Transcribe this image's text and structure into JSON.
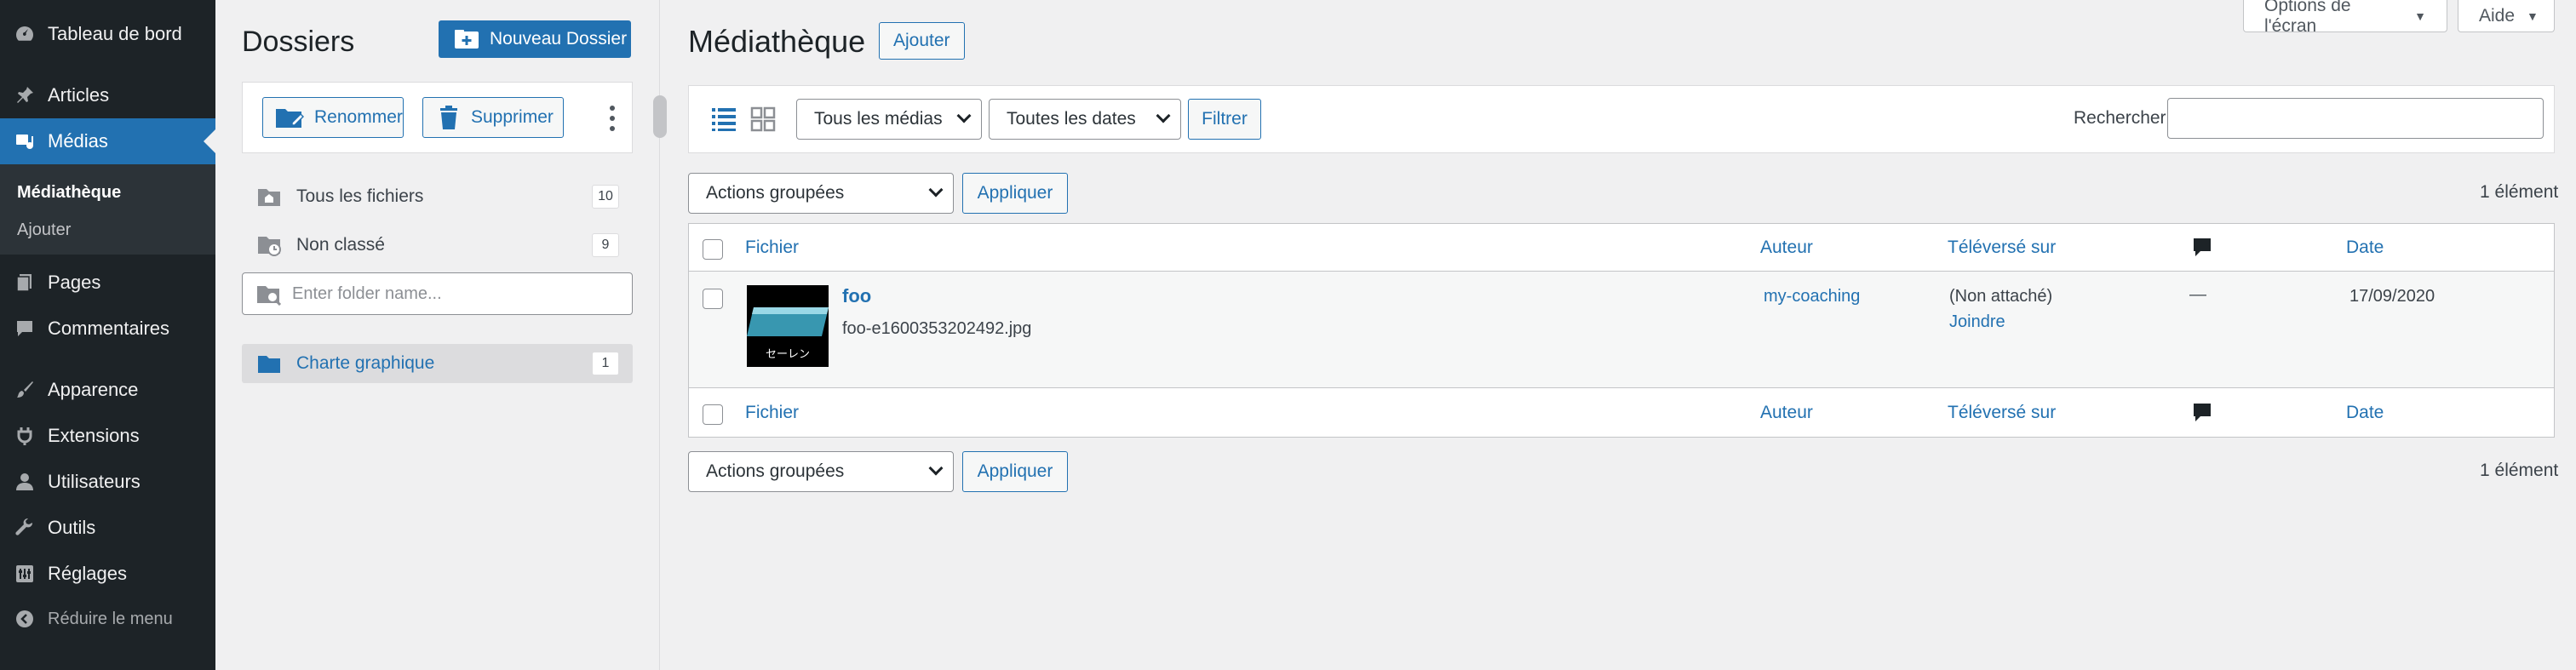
{
  "sidebar": {
    "items": [
      {
        "label": "Tableau de bord",
        "icon": "dashboard-icon"
      },
      {
        "label": "Articles",
        "icon": "pin-icon"
      },
      {
        "label": "Médias",
        "icon": "media-icon"
      },
      {
        "label": "Pages",
        "icon": "pages-icon"
      },
      {
        "label": "Commentaires",
        "icon": "comments-icon"
      },
      {
        "label": "Apparence",
        "icon": "brush-icon"
      },
      {
        "label": "Extensions",
        "icon": "plugin-icon"
      },
      {
        "label": "Utilisateurs",
        "icon": "user-icon"
      },
      {
        "label": "Outils",
        "icon": "wrench-icon"
      },
      {
        "label": "Réglages",
        "icon": "settings-icon"
      }
    ],
    "submenu": [
      {
        "label": "Médiathèque"
      },
      {
        "label": "Ajouter"
      }
    ],
    "collapse_label": "Réduire le menu"
  },
  "folders": {
    "title": "Dossiers",
    "new_folder_label": "Nouveau Dossier",
    "rename_label": "Renommer",
    "delete_label": "Supprimer",
    "all_files": {
      "label": "Tous les fichiers",
      "count": "10"
    },
    "uncategorized": {
      "label": "Non classé",
      "count": "9"
    },
    "search_placeholder": "Enter folder name...",
    "items": [
      {
        "label": "Charte graphique",
        "count": "1"
      }
    ]
  },
  "header": {
    "screen_options": "Options de l'écran",
    "help": "Aide"
  },
  "main": {
    "title": "Médiathèque",
    "add_label": "Ajouter",
    "filters": {
      "media_type": "Tous les médias",
      "dates": "Toutes les dates",
      "filter_label": "Filtrer",
      "search_label": "Rechercher"
    },
    "bulk": {
      "select_label": "Actions groupées",
      "apply_label": "Appliquer",
      "count": "1 élément"
    },
    "table": {
      "columns": [
        "Fichier",
        "Auteur",
        "Téléversé sur",
        "Date"
      ],
      "rows": [
        {
          "title": "foo",
          "filename": "foo-e1600353202492.jpg",
          "thumb_text": "セーレン",
          "author": "my-coaching",
          "uploaded_to": "(Non attaché)",
          "attach_label": "Joindre",
          "comments": "—",
          "date": "17/09/2020"
        }
      ]
    }
  },
  "colors": {
    "sidebar_bg": "#1d2327",
    "accent": "#2271b1",
    "page_bg": "#f0f0f1"
  }
}
